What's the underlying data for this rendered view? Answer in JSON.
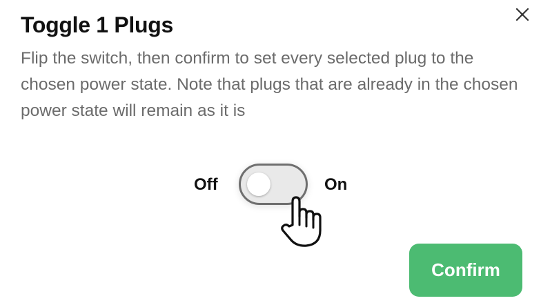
{
  "dialog": {
    "title": "Toggle 1 Plugs",
    "description": "Flip the switch, then confirm to set every selected plug to the chosen power state. Note that plugs that are already in the chosen power state will remain as it is",
    "close_icon": "close-icon"
  },
  "power_switch": {
    "off_label": "Off",
    "on_label": "On",
    "state": "off"
  },
  "cursor_icon": "pointing-hand-icon",
  "confirm_button": {
    "label": "Confirm",
    "color": "#4cbb72"
  }
}
